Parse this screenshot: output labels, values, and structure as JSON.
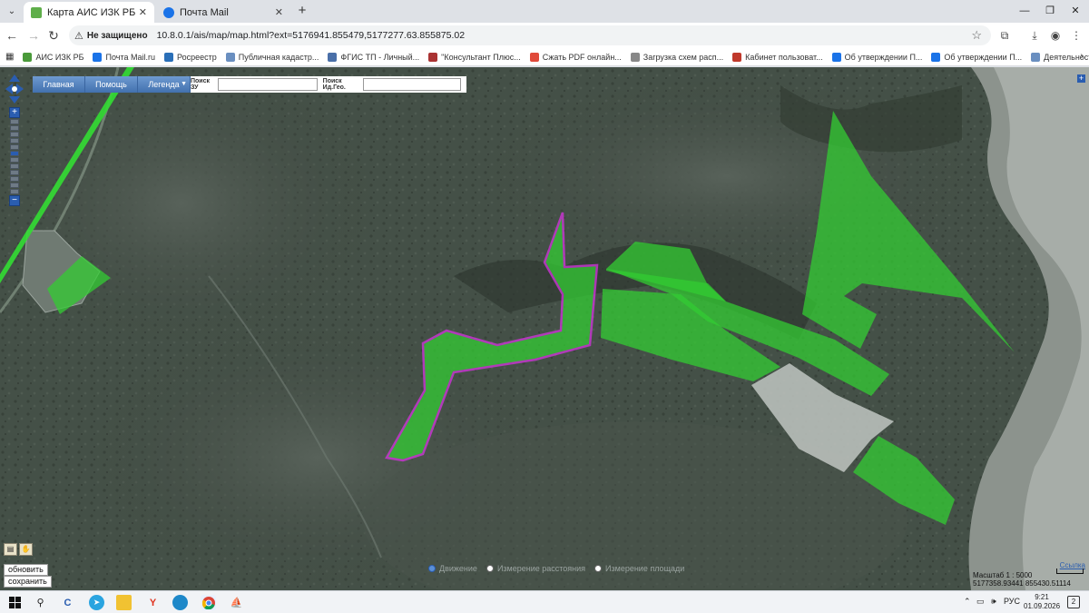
{
  "browser": {
    "tabs": [
      {
        "title": "Карта АИС ИЗК РБ",
        "active": true,
        "icon": "map-leaf-icon"
      },
      {
        "title": "Почта Mail",
        "active": false,
        "icon": "mail-icon"
      }
    ],
    "security_label": "Не защищено",
    "url": "10.8.0.1/ais/map/map.html?ext=5176941.855479,5177277.63.855875.02",
    "bookmarks": [
      {
        "label": "АИС ИЗК РБ",
        "color": "#4a9a3a"
      },
      {
        "label": "Почта Mail.ru",
        "color": "#1a73e8"
      },
      {
        "label": "Росреестр",
        "color": "#2a6fb8"
      },
      {
        "label": "Публичная кадастр...",
        "color": "#6a8fc0"
      },
      {
        "label": "ФГИС ТП - Личный...",
        "color": "#4a6fa8"
      },
      {
        "label": "\"Консультант Плюс...",
        "color": "#a33"
      },
      {
        "label": "Сжать PDF онлайн...",
        "color": "#e04a3a"
      },
      {
        "label": "Загрузка схем расп...",
        "color": "#888"
      },
      {
        "label": "Кабинет пользоват...",
        "color": "#c0392b"
      },
      {
        "label": "Об утверждении П...",
        "color": "#1a73e8"
      },
      {
        "label": "Об утверждении П...",
        "color": "#1a73e8"
      },
      {
        "label": "Деятельность | Адм...",
        "color": "#6a8fc0"
      }
    ]
  },
  "map": {
    "nav": {
      "home": "Главная",
      "help": "Помощь",
      "legend": "Легенда"
    },
    "search": {
      "zu_label": "Поиск ЗУ",
      "geo_label": "Поиск Ид.Гео."
    },
    "buttons": {
      "refresh": "обновить",
      "save": "сохранить"
    },
    "modes": [
      {
        "label": "Движение",
        "selected": true
      },
      {
        "label": "Измерение расстояния",
        "selected": false
      },
      {
        "label": "Измерение площади",
        "selected": false
      }
    ],
    "scale": {
      "label": "Масштаб 1 : 5000",
      "coords": "5177358.93441  855430.51114",
      "ruler": "10 м"
    },
    "link_ref": "Ссылка",
    "colors": {
      "parcel": "#33cc33",
      "selection": "#d633e0",
      "nav_button": "#4f7fbf"
    }
  },
  "taskbar": {
    "lang": "РУС",
    "time": "9:21",
    "date": "01.09.2026",
    "notifications": "2"
  }
}
